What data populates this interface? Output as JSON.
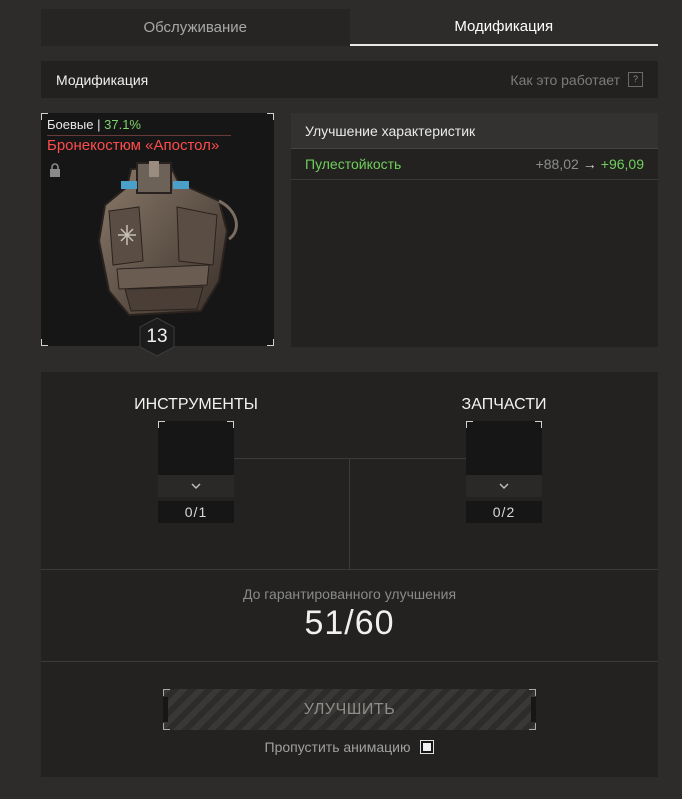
{
  "tabs": [
    {
      "label": "Обслуживание",
      "active": false
    },
    {
      "label": "Модификация",
      "active": true
    }
  ],
  "header": {
    "title": "Модификация",
    "how_it_works": "Как это работает",
    "help_glyph": "?"
  },
  "item": {
    "category": "Боевые",
    "separator": "|",
    "percent": "37.1%",
    "name": "Бронекостюм «Апостол»",
    "level": "13",
    "icons": [
      "lock-icon",
      "armor-image"
    ]
  },
  "stats": {
    "header": "Улучшение характеристик",
    "rows": [
      {
        "name": "Пулестойкость",
        "old": "+88,02",
        "arrow": "→",
        "new": "+96,09"
      }
    ]
  },
  "components": {
    "tools": {
      "label": "ИНСТРУМЕНТЫ",
      "count": "0/1"
    },
    "parts": {
      "label": "ЗАПЧАСТИ",
      "count": "0/2"
    },
    "dropdown_glyph": "⌄"
  },
  "guarantee": {
    "label": "До гарантированного улучшения",
    "value": "51/60"
  },
  "upgrade_button": "УЛУЧШИТЬ",
  "skip_animation": {
    "label": "Пропустить анимацию",
    "checked": true
  },
  "colors": {
    "background": "#2e2c2a",
    "panel": "#232221",
    "accent_green": "#6fcf5a",
    "item_name_red": "#ff4c4c"
  }
}
